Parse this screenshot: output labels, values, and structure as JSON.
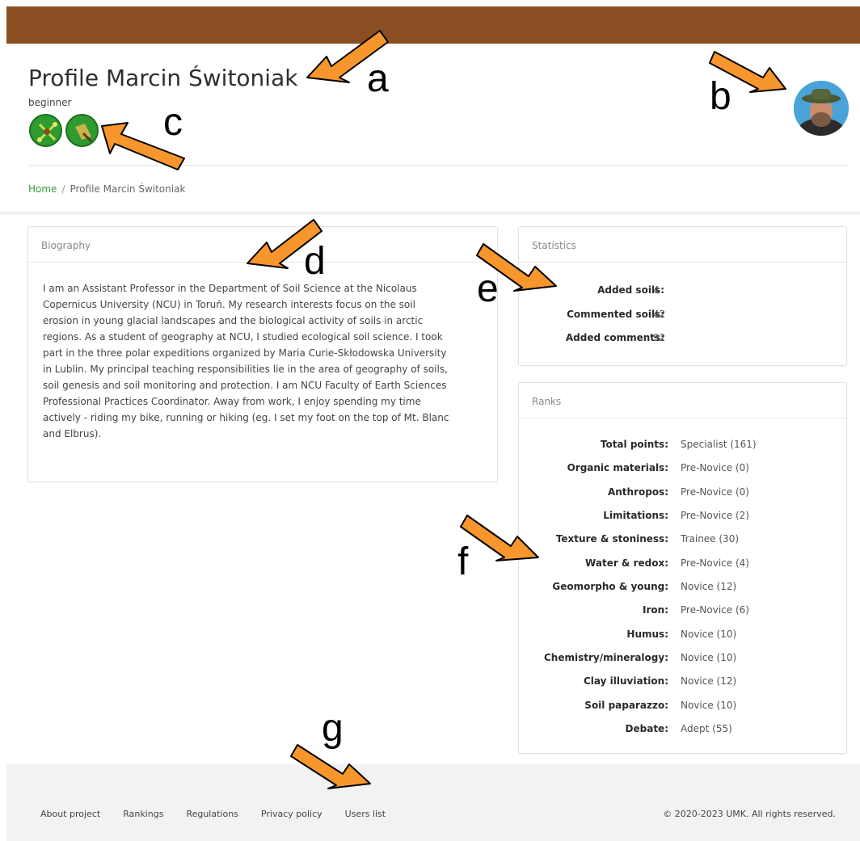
{
  "header": {
    "title": "Profile Marcin Świtoniak",
    "level": "beginner",
    "brand_color": "#8b4d22"
  },
  "badges": [
    {
      "icon": "soil-tools-badge-icon"
    },
    {
      "icon": "shovel-badge-icon"
    }
  ],
  "breadcrumb": {
    "home": "Home",
    "separator": "/",
    "current": "Profile Marcin Świtoniak"
  },
  "biography": {
    "heading": "Biography",
    "lines": [
      "I am an Assistant Professor in the Department of Soil Science at the Nicolaus",
      "Copernicus University (NCU) in Toruń. My research interests focus on the soil",
      "erosion in young glacial landscapes and the biological activity of soils in arctic",
      "regions. As a student of geography at NCU, I studied ecological soil science. I took",
      "part in the three polar expeditions organized by Maria Curie-Skłodowska University",
      "in Lublin. My principal teaching responsibilities lie in the area of geography of soils,",
      "soil genesis and soil monitoring and protection. I am NCU Faculty of Earth Sciences",
      "Professional Practices Coordinator. Away from work, I enjoy spending my time",
      "actively - riding my bike, running or hiking (eg. I set my foot on the top of Mt. Blanc",
      "and Elbrus)."
    ]
  },
  "statistics": {
    "heading": "Statistics",
    "rows": [
      {
        "label": "Added soils:",
        "value": "4"
      },
      {
        "label": "Commented soils:",
        "value": "42"
      },
      {
        "label": "Added comments:",
        "value": "92"
      }
    ]
  },
  "ranks": {
    "heading": "Ranks",
    "rows": [
      {
        "label": "Total points:",
        "value": "Specialist (161)"
      },
      {
        "label": "Organic materials:",
        "value": "Pre-Novice (0)"
      },
      {
        "label": "Anthropos:",
        "value": "Pre-Novice (0)"
      },
      {
        "label": "Limitations:",
        "value": "Pre-Novice (2)"
      },
      {
        "label": "Texture & stoniness:",
        "value": "Trainee (30)"
      },
      {
        "label": "Water & redox:",
        "value": "Pre-Novice (4)"
      },
      {
        "label": "Geomorpho & young:",
        "value": "Novice (12)"
      },
      {
        "label": "Iron:",
        "value": "Pre-Novice (6)"
      },
      {
        "label": "Humus:",
        "value": "Novice (10)"
      },
      {
        "label": "Chemistry/mineralogy:",
        "value": "Novice (10)"
      },
      {
        "label": "Clay illuviation:",
        "value": "Novice (12)"
      },
      {
        "label": "Soil paparazzo:",
        "value": "Novice (10)"
      },
      {
        "label": "Debate:",
        "value": "Adept (55)"
      }
    ]
  },
  "footer": {
    "links": [
      "About project",
      "Rankings",
      "Regulations",
      "Privacy policy",
      "Users list"
    ],
    "copyright": "© 2020-2023 UMK. All rights reserved."
  },
  "annotations": {
    "color": "#f7962c",
    "letters": [
      "a",
      "b",
      "c",
      "d",
      "e",
      "f",
      "g"
    ]
  }
}
